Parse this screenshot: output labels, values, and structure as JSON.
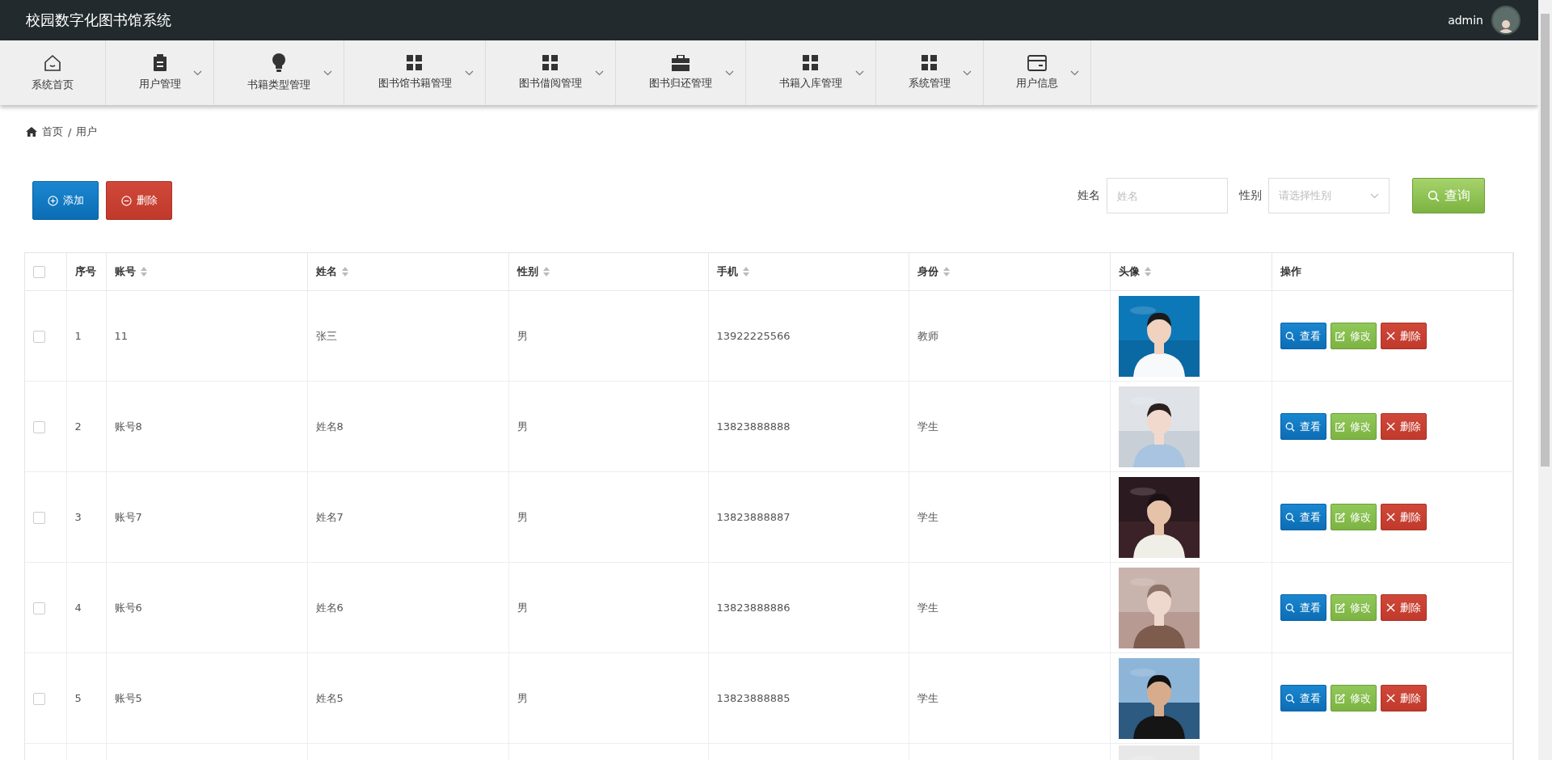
{
  "header": {
    "title": "校园数字化图书馆系统",
    "user": "admin"
  },
  "nav": [
    {
      "label": "系统首页",
      "has_dropdown": false
    },
    {
      "label": "用户管理",
      "has_dropdown": true
    },
    {
      "label": "书籍类型管理",
      "has_dropdown": true
    },
    {
      "label": "图书馆书籍管理",
      "has_dropdown": true
    },
    {
      "label": "图书借阅管理",
      "has_dropdown": true
    },
    {
      "label": "图书归还管理",
      "has_dropdown": true
    },
    {
      "label": "书籍入库管理",
      "has_dropdown": true
    },
    {
      "label": "系统管理",
      "has_dropdown": true
    },
    {
      "label": "用户信息",
      "has_dropdown": true
    }
  ],
  "breadcrumb": [
    "首页",
    "用户"
  ],
  "breadcrumb_separator": "/",
  "toolbar": {
    "buttons": [
      {
        "kind": "add",
        "label": "添加"
      },
      {
        "kind": "delete",
        "label": "删除"
      }
    ]
  },
  "search": {
    "name_label": "姓名",
    "name_placeholder": "姓名",
    "gender_label": "性别",
    "gender_placeholder": "请选择性别",
    "button": "查询"
  },
  "table": {
    "header_checked": false,
    "columns": [
      {
        "label": "序号",
        "sortable": false
      },
      {
        "label": "账号",
        "sortable": true
      },
      {
        "label": "姓名",
        "sortable": true
      },
      {
        "label": "性别",
        "sortable": true
      },
      {
        "label": "手机",
        "sortable": true
      },
      {
        "label": "身份",
        "sortable": true
      },
      {
        "label": "头像",
        "sortable": true
      },
      {
        "label": "操作",
        "sortable": false
      }
    ],
    "rows": [
      {
        "checked": false,
        "index": "1",
        "account": "11",
        "name": "张三",
        "gender": "男",
        "phone": "13922225566",
        "role": "教师",
        "actions": [
          {
            "kind": "view",
            "label": "查看"
          },
          {
            "kind": "edit",
            "label": "修改"
          },
          {
            "kind": "delete",
            "label": "删除"
          }
        ]
      },
      {
        "checked": false,
        "index": "2",
        "account": "账号8",
        "name": "姓名8",
        "gender": "男",
        "phone": "13823888888",
        "role": "学生",
        "actions": [
          {
            "kind": "view",
            "label": "查看"
          },
          {
            "kind": "edit",
            "label": "修改"
          },
          {
            "kind": "delete",
            "label": "删除"
          }
        ]
      },
      {
        "checked": false,
        "index": "3",
        "account": "账号7",
        "name": "姓名7",
        "gender": "男",
        "phone": "13823888887",
        "role": "学生",
        "actions": [
          {
            "kind": "view",
            "label": "查看"
          },
          {
            "kind": "edit",
            "label": "修改"
          },
          {
            "kind": "delete",
            "label": "删除"
          }
        ]
      },
      {
        "checked": false,
        "index": "4",
        "account": "账号6",
        "name": "姓名6",
        "gender": "男",
        "phone": "13823888886",
        "role": "学生",
        "actions": [
          {
            "kind": "view",
            "label": "查看"
          },
          {
            "kind": "edit",
            "label": "修改"
          },
          {
            "kind": "delete",
            "label": "删除"
          }
        ]
      },
      {
        "checked": false,
        "index": "5",
        "account": "账号5",
        "name": "姓名5",
        "gender": "男",
        "phone": "13823888885",
        "role": "学生",
        "actions": [
          {
            "kind": "view",
            "label": "查看"
          },
          {
            "kind": "edit",
            "label": "修改"
          },
          {
            "kind": "delete",
            "label": "删除"
          }
        ]
      }
    ]
  }
}
